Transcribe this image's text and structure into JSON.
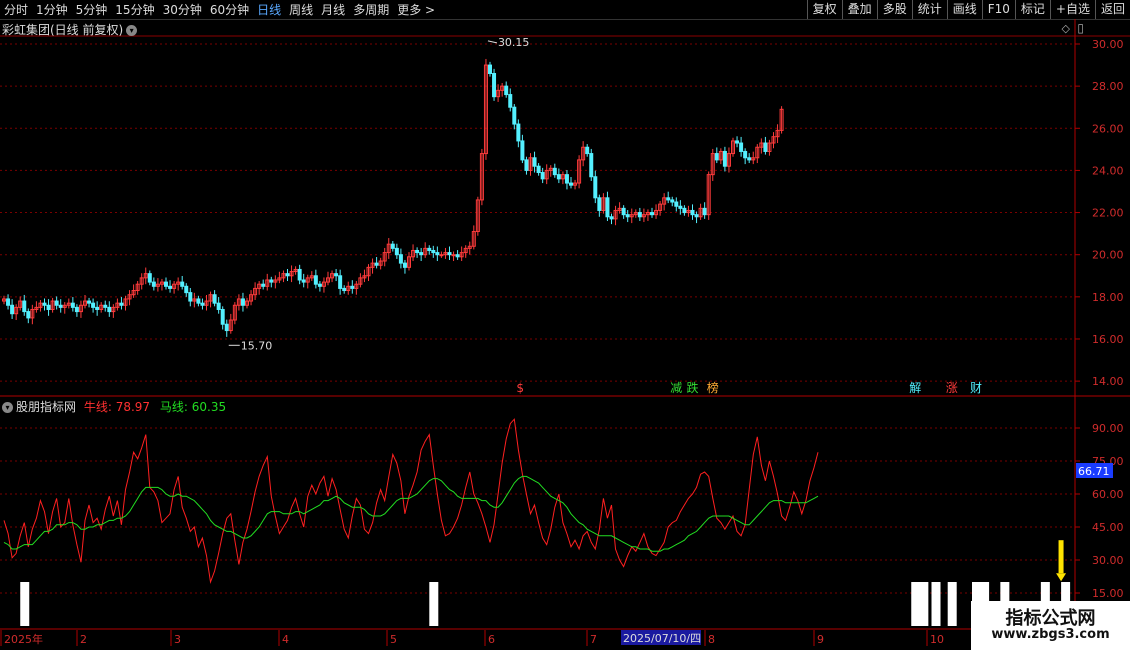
{
  "toolbar": {
    "periods": [
      "分时",
      "1分钟",
      "5分钟",
      "15分钟",
      "30分钟",
      "60分钟",
      "日线",
      "周线",
      "月线",
      "多周期",
      "更多 >"
    ],
    "active": "日线",
    "right": [
      "复权",
      "叠加",
      "多股",
      "统计",
      "画线",
      "F10",
      "标记",
      "+自选",
      "返回"
    ]
  },
  "main_title": "彩虹集团(日线 前复权)",
  "indicator": {
    "name": "股朋指标网",
    "line1_label": "牛线: 78.97",
    "line2_label": "马线: 60.35",
    "current_value": "66.71"
  },
  "colors": {
    "up": "#ff3b3b",
    "down": "#54f0ff",
    "line1": "#ff2020",
    "line2": "#22dd22",
    "grid": "#7a0000",
    "axis_text": "#d02c2c",
    "signal": "#ffe300"
  },
  "watermark": {
    "line1": "指标公式网",
    "line2": "www.zbgs3.com"
  },
  "chart_data": [
    {
      "type": "candlestick",
      "title": "彩虹集团(日线 前复权)",
      "ylim": [
        13.5,
        31
      ],
      "y_ticks": [
        "30.00",
        "28.00",
        "26.00",
        "24.00",
        "22.00",
        "20.00",
        "18.00",
        "16.00",
        "14.00"
      ],
      "annotations": [
        {
          "text": "30.15",
          "value": 30.15
        },
        {
          "text": "15.70",
          "value": 15.7
        }
      ],
      "event_markers": [
        "$",
        "减",
        "跌",
        "榜",
        "解",
        "涨",
        "财"
      ],
      "closes": [
        17.9,
        17.6,
        17.2,
        17.5,
        17.8,
        17.3,
        17.0,
        17.4,
        17.5,
        17.7,
        17.6,
        17.4,
        17.8,
        17.6,
        17.5,
        17.6,
        17.7,
        17.5,
        17.3,
        17.6,
        17.8,
        17.7,
        17.5,
        17.4,
        17.6,
        17.5,
        17.3,
        17.5,
        17.7,
        17.6,
        17.9,
        18.1,
        18.3,
        18.6,
        18.9,
        19.1,
        18.7,
        18.5,
        18.6,
        18.7,
        18.5,
        18.4,
        18.6,
        18.7,
        18.5,
        18.2,
        17.8,
        17.9,
        17.7,
        17.6,
        17.8,
        18.1,
        17.7,
        17.4,
        16.7,
        16.4,
        16.9,
        17.6,
        17.9,
        17.6,
        17.8,
        18.1,
        18.4,
        18.6,
        18.5,
        18.8,
        18.7,
        18.8,
        18.9,
        19.1,
        19.0,
        19.2,
        19.3,
        18.8,
        18.7,
        18.9,
        19.0,
        18.6,
        18.5,
        18.7,
        18.9,
        19.1,
        19.0,
        18.4,
        18.3,
        18.5,
        18.4,
        18.6,
        18.9,
        19.0,
        19.4,
        19.6,
        19.5,
        19.7,
        20.1,
        20.5,
        20.3,
        20.0,
        19.6,
        19.4,
        19.9,
        20.2,
        20.1,
        20.0,
        20.3,
        20.2,
        20.1,
        20.0,
        20.0,
        20.1,
        20.0,
        20.0,
        19.9,
        20.1,
        20.3,
        20.4,
        21.1,
        22.6,
        24.8,
        29.0,
        28.6,
        27.5,
        27.8,
        28.0,
        27.6,
        27.0,
        26.2,
        25.4,
        24.5,
        24.0,
        24.6,
        24.2,
        23.9,
        23.6,
        24.0,
        24.1,
        23.8,
        23.6,
        23.8,
        23.4,
        23.3,
        23.4,
        24.5,
        25.1,
        24.8,
        23.7,
        22.7,
        22.1,
        22.7,
        21.8,
        21.7,
        22.1,
        22.2,
        21.9,
        21.8,
        21.9,
        22.0,
        21.8,
        21.9,
        22.0,
        21.9,
        22.1,
        22.4,
        22.7,
        22.6,
        22.5,
        22.3,
        22.2,
        22.0,
        22.1,
        21.9,
        21.8,
        22.2,
        21.9,
        23.8,
        24.8,
        24.5,
        24.9,
        24.2,
        24.8,
        25.4,
        25.3,
        24.9,
        24.6,
        24.5,
        24.6,
        25.1,
        25.3,
        24.9,
        25.3,
        25.6,
        25.9,
        26.9
      ]
    },
    {
      "type": "line",
      "title": "股朋指标网",
      "ylim": [
        10,
        100
      ],
      "y_ticks": [
        "90.00",
        "75.00",
        "60.00",
        "45.00",
        "30.00",
        "15.00"
      ],
      "series": [
        {
          "name": "牛线",
          "values": [
            48,
            42,
            31,
            33,
            41,
            47,
            36,
            44,
            49,
            57,
            52,
            42,
            52,
            58,
            45,
            47,
            58,
            46,
            37,
            29,
            48,
            55,
            47,
            49,
            44,
            53,
            59,
            50,
            57,
            46,
            62,
            70,
            79,
            76,
            81,
            87,
            63,
            61,
            57,
            47,
            49,
            51,
            62,
            68,
            54,
            49,
            43,
            45,
            36,
            40,
            32,
            20,
            25,
            33,
            42,
            49,
            51,
            39,
            28,
            38,
            44,
            52,
            61,
            68,
            73,
            77,
            59,
            50,
            42,
            45,
            48,
            54,
            58,
            51,
            45,
            59,
            64,
            60,
            65,
            68,
            59,
            67,
            62,
            53,
            44,
            40,
            50,
            58,
            55,
            44,
            42,
            47,
            56,
            62,
            57,
            68,
            78,
            74,
            66,
            51,
            59,
            64,
            70,
            80,
            84,
            87,
            73,
            60,
            48,
            41,
            42,
            45,
            49,
            55,
            63,
            70,
            60,
            56,
            51,
            45,
            38,
            46,
            60,
            74,
            85,
            92,
            94,
            80,
            69,
            60,
            51,
            55,
            47,
            40,
            37,
            44,
            54,
            60,
            47,
            42,
            36,
            39,
            35,
            41,
            43,
            38,
            35,
            44,
            58,
            49,
            55,
            35,
            30,
            27,
            32,
            36,
            34,
            38,
            42,
            36,
            33,
            32,
            35,
            38,
            45,
            47,
            48,
            52,
            55,
            58,
            60,
            63,
            69,
            70,
            68,
            58,
            49,
            47,
            44,
            47,
            50,
            43,
            41,
            46,
            62,
            78,
            86,
            73,
            66,
            75,
            68,
            60,
            50,
            48,
            54,
            61,
            57,
            51,
            57,
            66,
            72,
            79
          ]
        },
        {
          "name": "马线",
          "values": [
            38,
            37,
            35,
            35,
            36,
            37,
            37,
            37,
            39,
            41,
            43,
            43,
            44,
            46,
            46,
            46,
            47,
            47,
            46,
            44,
            44,
            45,
            45,
            46,
            46,
            47,
            48,
            48,
            49,
            49,
            50,
            52,
            55,
            58,
            61,
            63,
            63,
            63,
            63,
            62,
            60,
            59,
            59,
            60,
            59,
            59,
            58,
            57,
            55,
            53,
            51,
            48,
            46,
            45,
            44,
            43,
            43,
            42,
            41,
            40,
            40,
            41,
            43,
            45,
            48,
            51,
            52,
            52,
            52,
            51,
            51,
            51,
            52,
            52,
            51,
            52,
            53,
            54,
            55,
            57,
            57,
            58,
            59,
            58,
            56,
            55,
            54,
            54,
            54,
            53,
            51,
            50,
            50,
            50,
            51,
            53,
            55,
            57,
            58,
            58,
            58,
            59,
            60,
            62,
            64,
            66,
            67,
            67,
            66,
            64,
            62,
            61,
            59,
            58,
            58,
            58,
            58,
            58,
            57,
            57,
            55,
            54,
            54,
            56,
            59,
            62,
            65,
            67,
            68,
            68,
            67,
            66,
            65,
            63,
            61,
            59,
            58,
            57,
            56,
            54,
            51,
            49,
            47,
            46,
            44,
            43,
            42,
            41,
            41,
            41,
            41,
            40,
            39,
            38,
            37,
            36,
            36,
            35,
            35,
            35,
            34,
            34,
            34,
            35,
            35,
            36,
            37,
            38,
            39,
            41,
            42,
            43,
            45,
            47,
            49,
            50,
            50,
            50,
            50,
            50,
            49,
            48,
            47,
            46,
            46,
            48,
            50,
            52,
            54,
            56,
            57,
            57,
            57,
            56,
            56,
            56,
            56,
            56,
            56,
            57,
            58,
            59
          ]
        }
      ],
      "signal_bars": [
        5,
        106,
        225,
        227,
        230,
        234,
        240,
        242,
        247,
        257,
        262
      ],
      "signal_arrow": 261
    }
  ],
  "x_axis": {
    "labels": [
      "2025年",
      "2",
      "3",
      "4",
      "5",
      "6",
      "7",
      "8",
      "9",
      "10"
    ],
    "highlight": "2025/07/10/四"
  }
}
